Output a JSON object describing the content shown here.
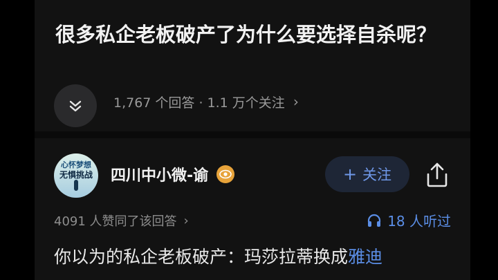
{
  "question": {
    "title": "很多私企老板破产了为什么要选择自杀呢？",
    "stats": "1,767 个回答 · 1.1 万个关注"
  },
  "author": {
    "avatar_text_line1": "心怀梦想",
    "avatar_text_line2": "无惧挑战",
    "name": "四川中小微-谕",
    "follow_label": "关注"
  },
  "answer_meta": {
    "approvals": "4091 人赞同了该回答",
    "listened": "18 人听过"
  },
  "answer": {
    "text_prefix": "你以为的私企老板破产：玛莎拉蒂换成",
    "text_link": "雅迪"
  },
  "colors": {
    "background": "#121212",
    "accent_blue": "#5b8ee6",
    "badge": "#e7a33a"
  }
}
